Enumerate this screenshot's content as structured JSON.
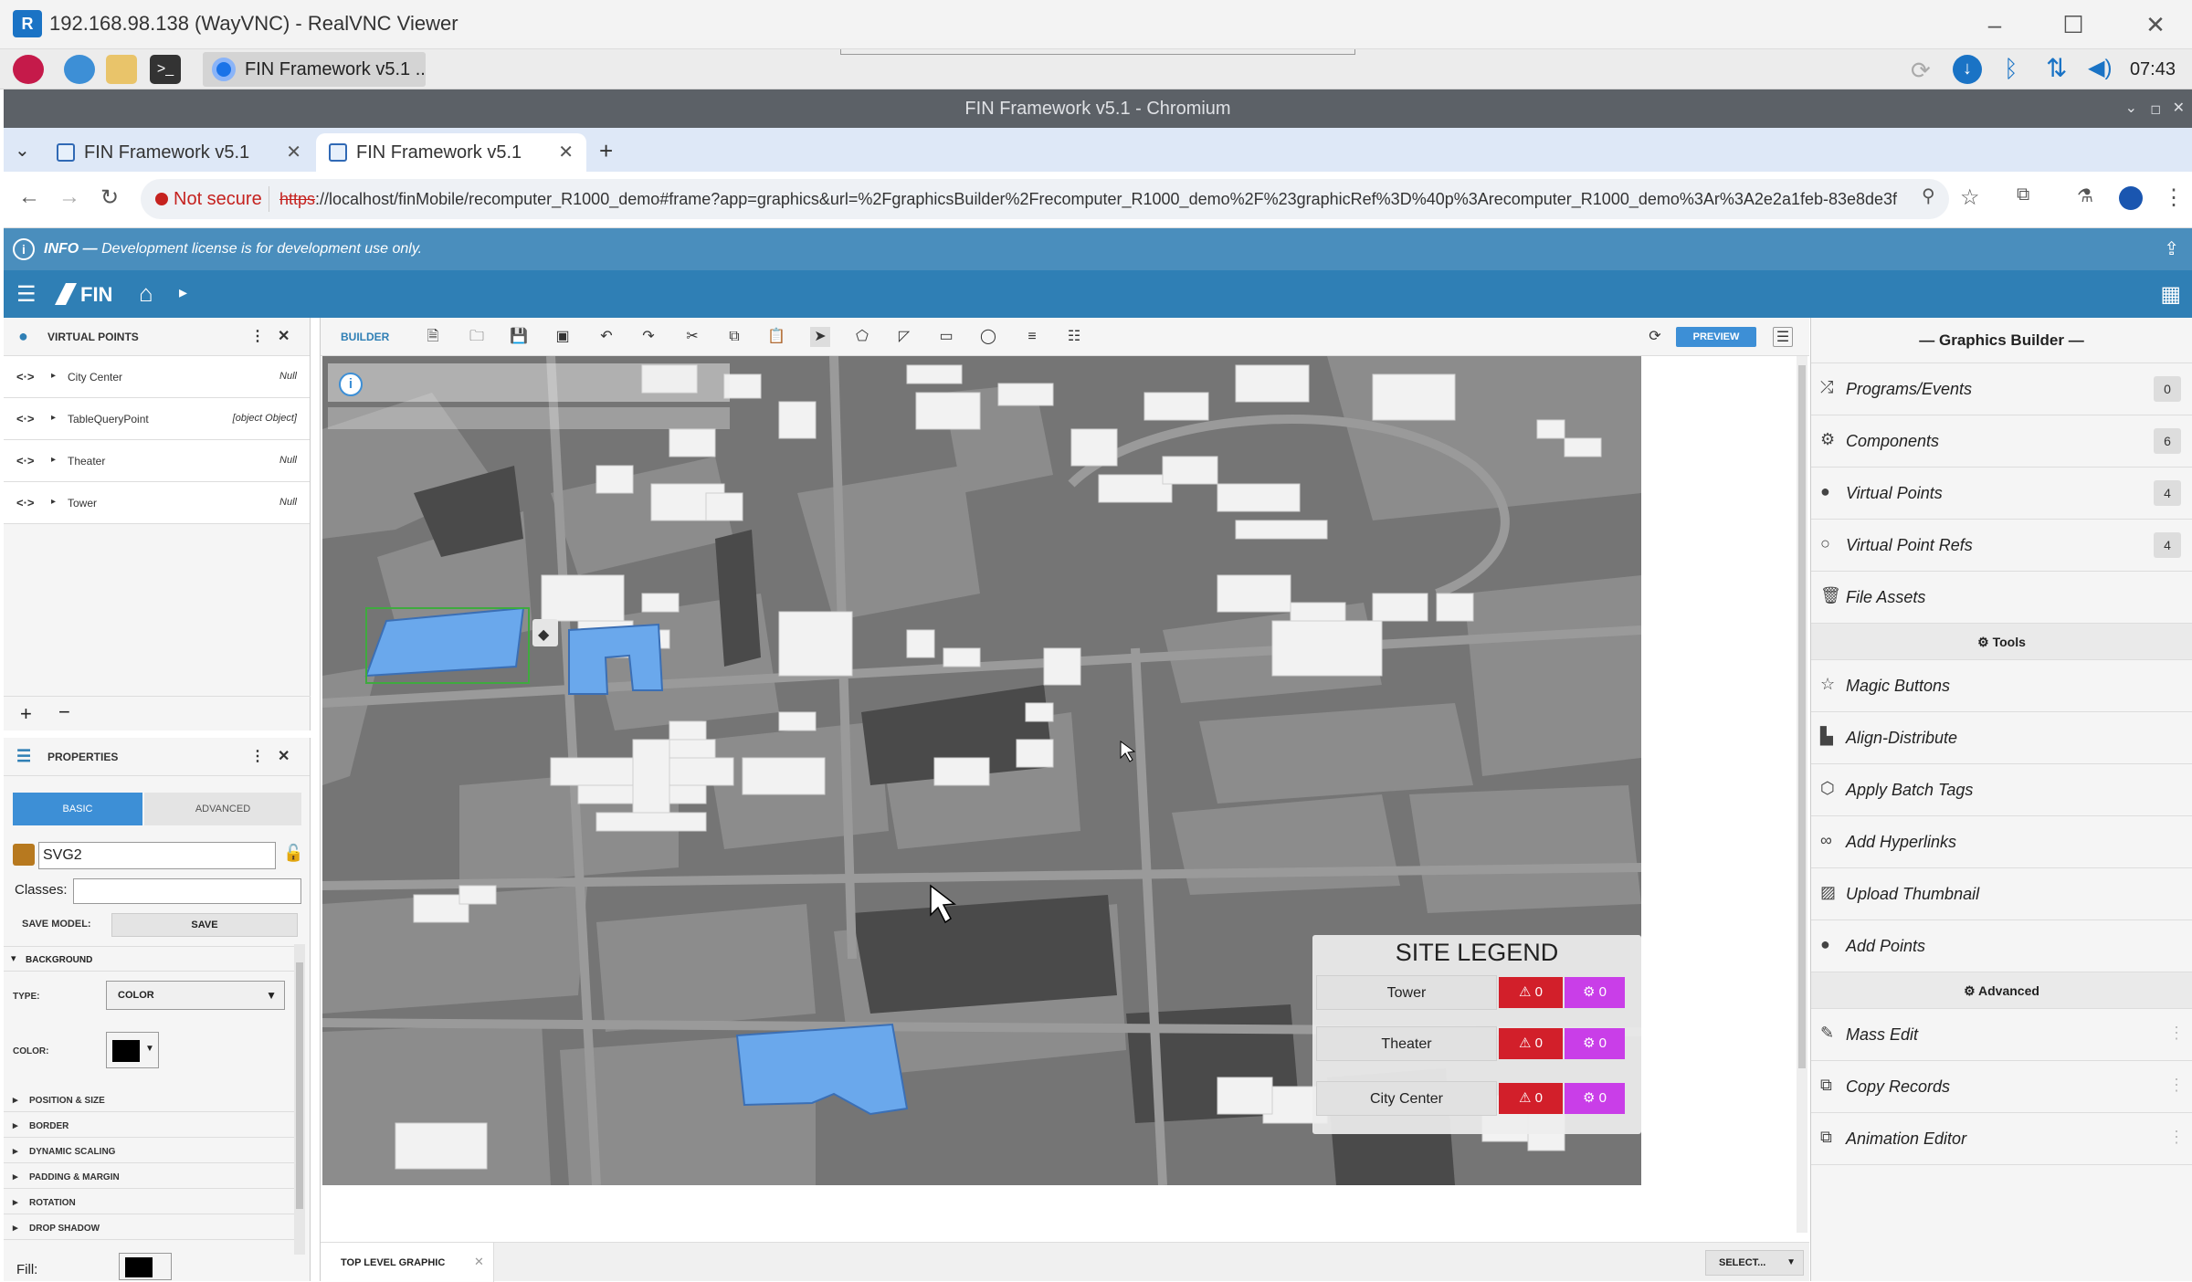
{
  "vnc": {
    "title": "192.168.98.138 (WayVNC) - RealVNC Viewer"
  },
  "taskbar": {
    "app_label": "FIN Framework v5.1 ..",
    "clock": "07:43"
  },
  "browser": {
    "window_title": "FIN Framework v5.1 - Chromium",
    "tabs": [
      {
        "label": "FIN Framework v5.1"
      },
      {
        "label": "FIN Framework v5.1"
      }
    ],
    "security_label": "Not secure",
    "url_scheme": "https",
    "url_rest": "://localhost/finMobile/recomputer_R1000_demo#frame?app=graphics&url=%2FgraphicsBuilder%2Frecomputer_R1000_demo%2F%23graphicRef%3D%40p%3Arecomputer_R1000_demo%3Ar%3A2e2a1feb-83e8de3f"
  },
  "info": {
    "prefix": "INFO — ",
    "message": "Development license is for development use only."
  },
  "virtual_points": {
    "title": "VIRTUAL POINTS",
    "rows": [
      {
        "name": "City Center",
        "value": "Null"
      },
      {
        "name": "TableQueryPoint",
        "value": "[object Object]"
      },
      {
        "name": "Theater",
        "value": "Null"
      },
      {
        "name": "Tower",
        "value": "Null"
      }
    ]
  },
  "properties": {
    "title": "PROPERTIES",
    "tabs": [
      "BASIC",
      "ADVANCED"
    ],
    "name_value": "SVG2",
    "classes_label": "Classes:",
    "save_model_label": "SAVE MODEL:",
    "save_button": "SAVE",
    "background_label": "BACKGROUND",
    "type_label": "TYPE:",
    "type_value": "COLOR",
    "color_label": "COLOR:",
    "sections": [
      "POSITION & SIZE",
      "BORDER",
      "DYNAMIC SCALING",
      "PADDING & MARGIN",
      "ROTATION",
      "DROP SHADOW"
    ],
    "fill_label": "Fill:"
  },
  "builder": {
    "tab_label": "BUILDER",
    "preview_button": "PREVIEW",
    "bottom_tab": "TOP LEVEL GRAPHIC",
    "select_button": "SELECT..."
  },
  "legend": {
    "title": "SITE LEGEND",
    "rows": [
      {
        "name": "Tower",
        "alarms": "0",
        "events": "0"
      },
      {
        "name": "Theater",
        "alarms": "0",
        "events": "0"
      },
      {
        "name": "City Center",
        "alarms": "0",
        "events": "0"
      }
    ]
  },
  "graphics_builder": {
    "title": "— Graphics Builder —",
    "items": [
      {
        "label": "Programs/Events",
        "count": "0"
      },
      {
        "label": "Components",
        "count": "6"
      },
      {
        "label": "Virtual Points",
        "count": "4"
      },
      {
        "label": "Virtual Point Refs",
        "count": "4"
      },
      {
        "label": "File Assets"
      }
    ],
    "tools_label": "Tools",
    "tools": [
      {
        "label": "Magic Buttons"
      },
      {
        "label": "Align-Distribute"
      },
      {
        "label": "Apply Batch Tags"
      },
      {
        "label": "Add Hyperlinks"
      },
      {
        "label": "Upload Thumbnail"
      },
      {
        "label": "Add Points"
      }
    ],
    "advanced_label": "Advanced",
    "advanced": [
      {
        "label": "Mass Edit"
      },
      {
        "label": "Copy Records"
      },
      {
        "label": "Animation Editor"
      }
    ]
  },
  "colors": {
    "accent": "#2f7fb5",
    "info_bar": "#4a8ebd",
    "highlight_building": "#6aa8ec",
    "alarm": "#d21f2a",
    "event": "#c93ee8"
  }
}
